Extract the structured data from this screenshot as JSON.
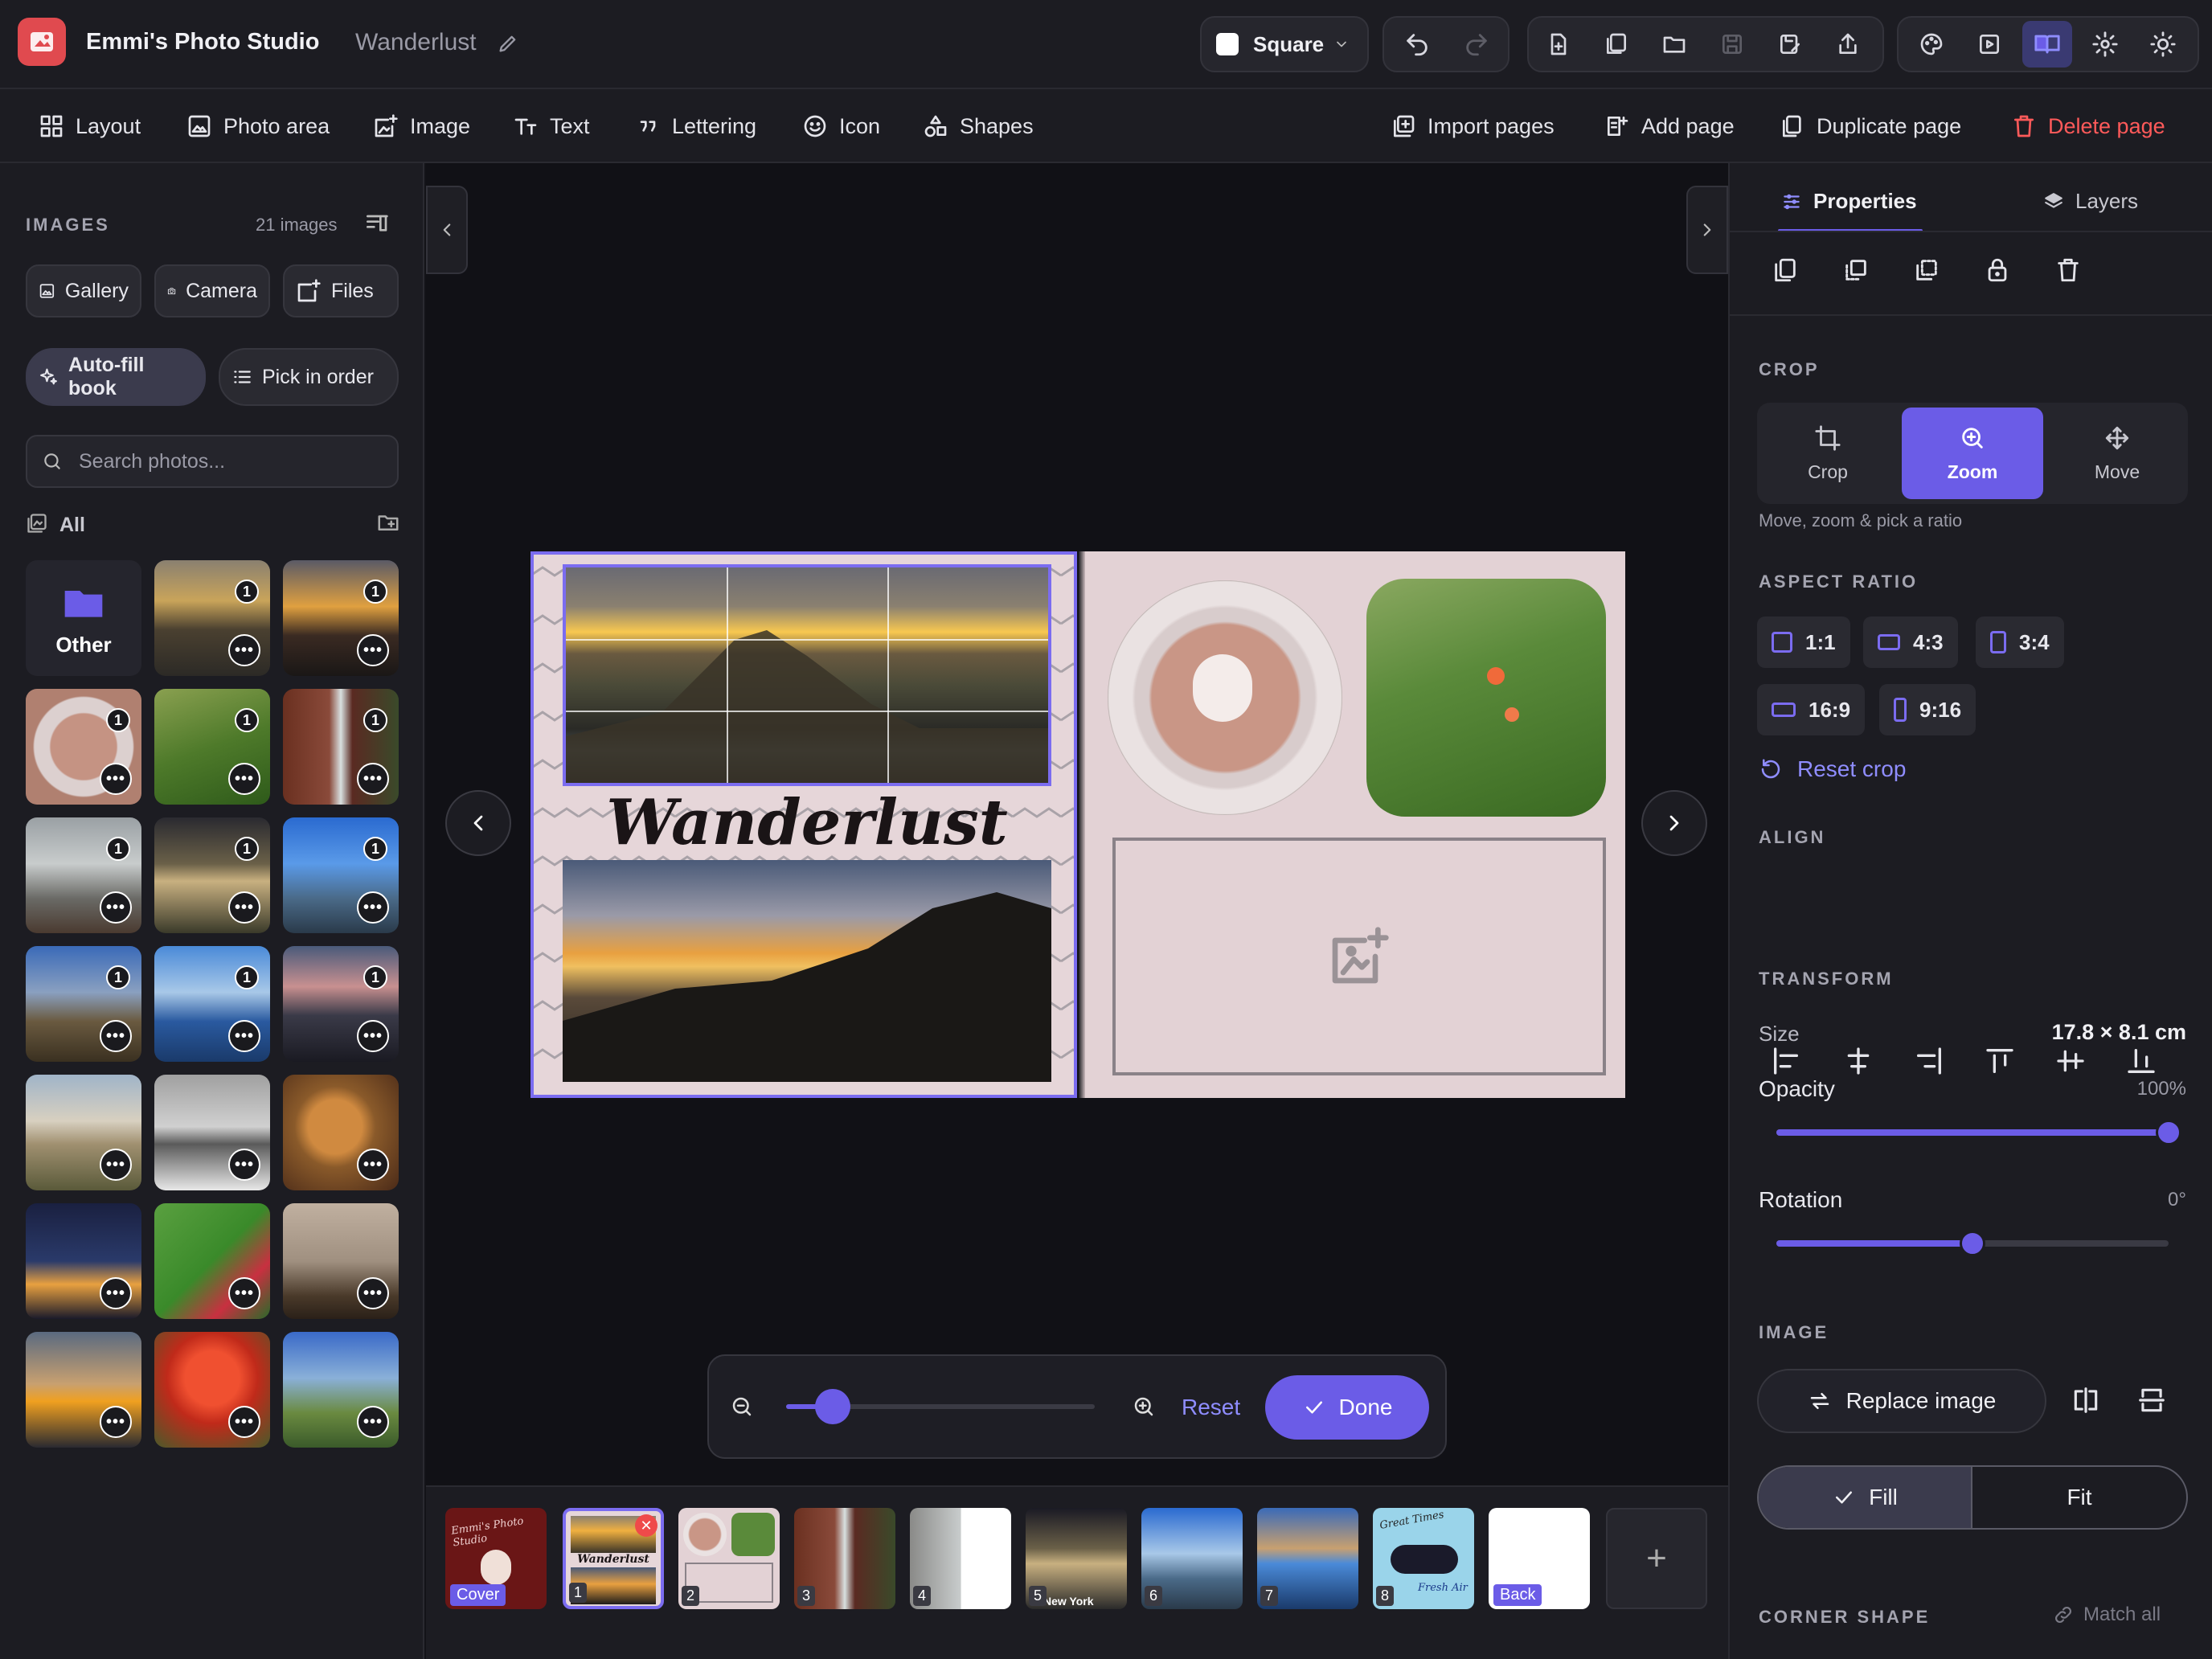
{
  "app": {
    "title": "Emmi's Photo Studio",
    "project": "Wanderlust"
  },
  "header": {
    "format_label": "Square"
  },
  "toolbar": {
    "tools": [
      "Layout",
      "Photo area",
      "Image",
      "Text",
      "Lettering",
      "Icon",
      "Shapes"
    ],
    "page_actions": [
      "Import pages",
      "Add page",
      "Duplicate page",
      "Delete page"
    ]
  },
  "left": {
    "section_title": "IMAGES",
    "count": "21 images",
    "sources": [
      "Gallery",
      "Camera",
      "Files"
    ],
    "autofill": "Auto-fill book",
    "pick_order": "Pick in order",
    "search_placeholder": "Search photos...",
    "folder_label": "All",
    "folder_tile": "Other"
  },
  "canvas": {
    "title_text": "Wanderlust",
    "zoom": {
      "reset": "Reset",
      "done": "Done",
      "level": 0.15
    }
  },
  "film": {
    "pages": [
      "Cover",
      "1",
      "2",
      "3",
      "4",
      "5",
      "6",
      "7",
      "8",
      "Back"
    ],
    "cover_title": "Emmi's Photo Studio",
    "page8_line1": "Great Times",
    "page8_line2": "Fresh Air",
    "page5_caption": "New York"
  },
  "right": {
    "tabs": [
      "Properties",
      "Layers"
    ],
    "crop_label": "CROP",
    "crop_modes": [
      "Crop",
      "Zoom",
      "Move"
    ],
    "crop_hint": "Move, zoom & pick a ratio",
    "aspect_label": "ASPECT RATIO",
    "ratios": [
      "1:1",
      "4:3",
      "3:4",
      "16:9",
      "9:16"
    ],
    "reset_crop": "Reset crop",
    "align_label": "ALIGN",
    "transform_label": "TRANSFORM",
    "size_label": "Size",
    "size_value": "17.8 × 8.1 cm",
    "opacity_label": "Opacity",
    "opacity_value": "100%",
    "opacity": 1.0,
    "rotation_label": "Rotation",
    "rotation_value": "0°",
    "rotation_level": 0.5,
    "image_label": "IMAGE",
    "replace": "Replace image",
    "fill": "Fill",
    "fit": "Fit",
    "corner_label": "CORNER SHAPE",
    "match_all": "Match all"
  },
  "colors": {
    "accent": "#6b5ce7",
    "danger": "#ff5a5a",
    "page_bg": "#e6d6d9"
  }
}
